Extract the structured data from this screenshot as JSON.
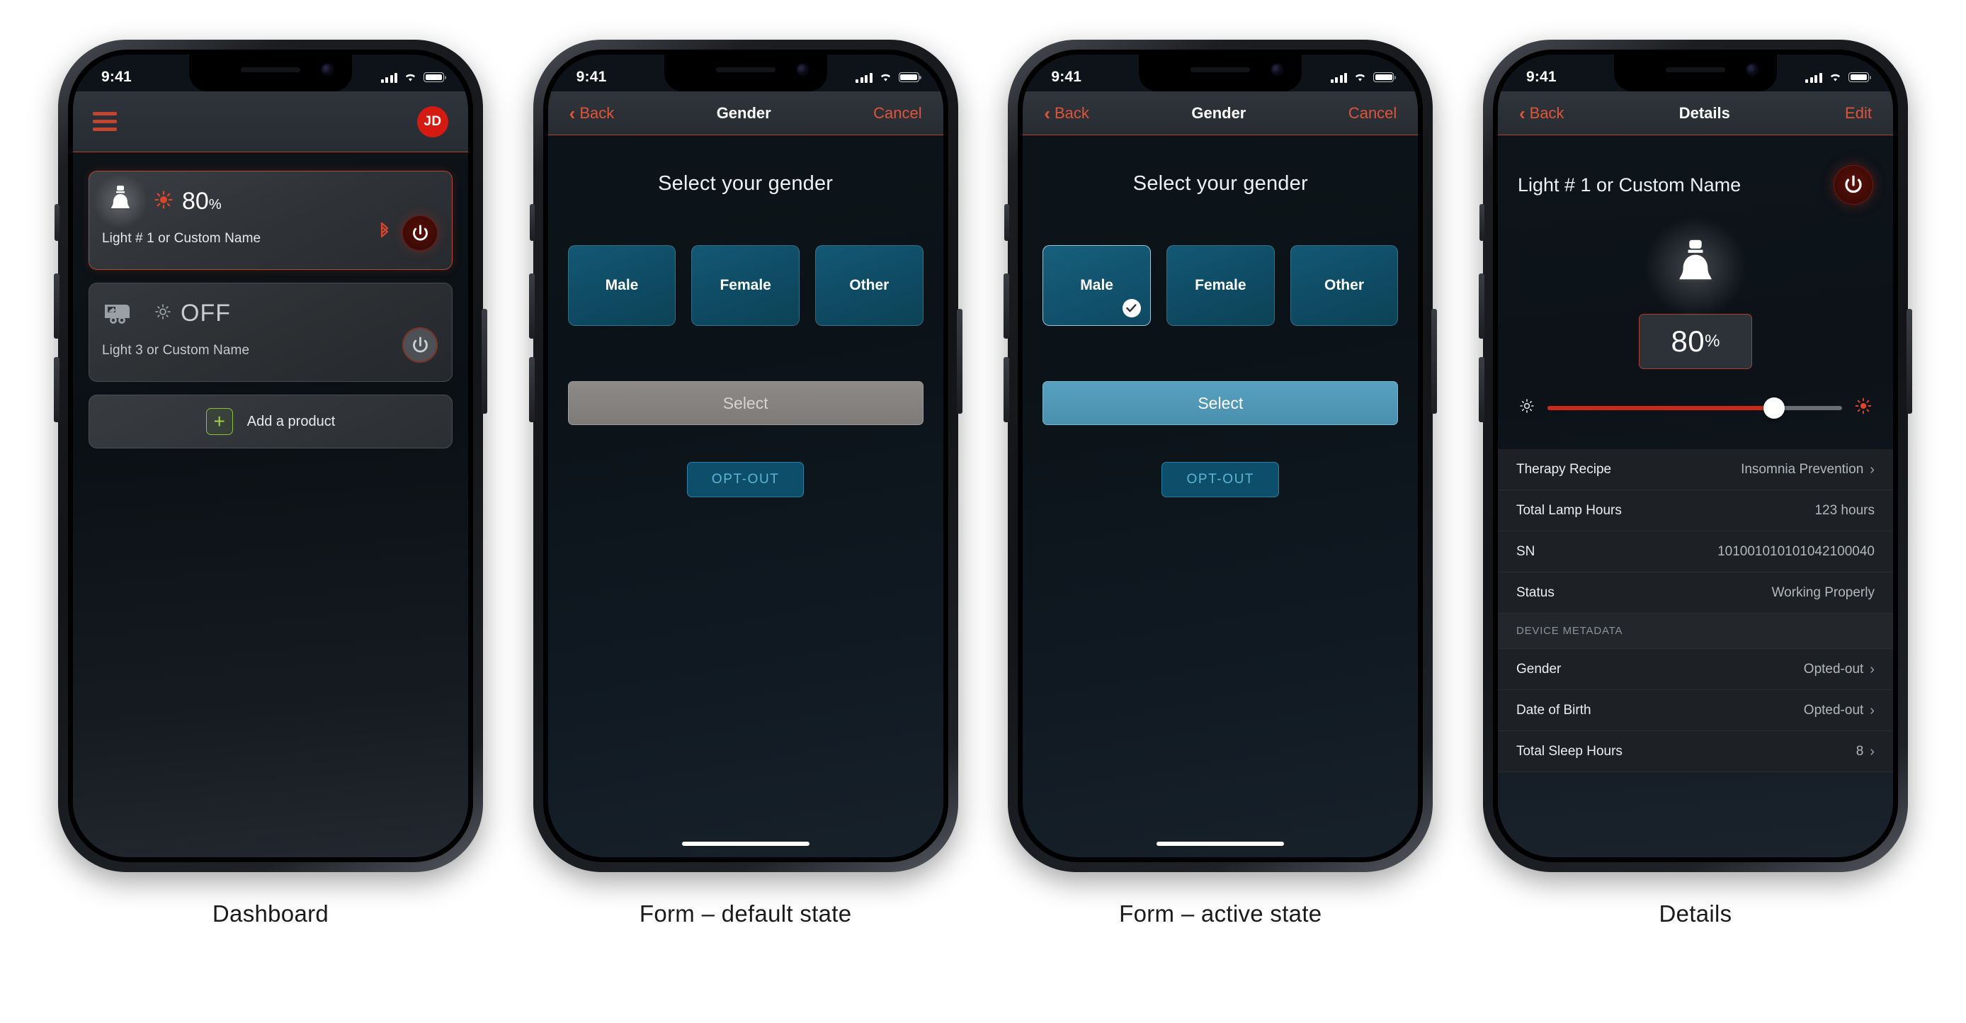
{
  "statusbar": {
    "time": "9:41"
  },
  "screens": [
    {
      "caption": "Dashboard",
      "header": {
        "menu_icon": "hamburger-menu-icon",
        "avatar_initials": "JD"
      },
      "devices": [
        {
          "icon": "light-bulb-icon",
          "brightness_icon": "sun-bright-icon",
          "value": "80",
          "unit": "%",
          "name": "Light # 1 or Custom Name",
          "bluetooth_icon": "bluetooth-icon",
          "power_icon": "power-icon",
          "state": "on"
        },
        {
          "icon": "trailer-icon",
          "brightness_icon": "sun-dim-icon",
          "value": "OFF",
          "unit": "",
          "name": "Light 3 or Custom Name",
          "bluetooth_icon": "",
          "power_icon": "power-icon",
          "state": "off"
        }
      ],
      "add_product": {
        "icon": "plus-icon",
        "label": "Add a product"
      }
    },
    {
      "caption": "Form – default state",
      "nav": {
        "back": "Back",
        "title": "Gender",
        "action": "Cancel"
      },
      "title": "Select your gender",
      "options": [
        {
          "label": "Male",
          "selected": false
        },
        {
          "label": "Female",
          "selected": false
        },
        {
          "label": "Other",
          "selected": false
        }
      ],
      "submit": {
        "label": "Select",
        "enabled": false
      },
      "optout": {
        "label": "OPT-OUT"
      }
    },
    {
      "caption": "Form – active state",
      "nav": {
        "back": "Back",
        "title": "Gender",
        "action": "Cancel"
      },
      "title": "Select your gender",
      "options": [
        {
          "label": "Male",
          "selected": true
        },
        {
          "label": "Female",
          "selected": false
        },
        {
          "label": "Other",
          "selected": false
        }
      ],
      "submit": {
        "label": "Select",
        "enabled": true
      },
      "optout": {
        "label": "OPT-OUT"
      }
    },
    {
      "caption": "Details",
      "nav": {
        "back": "Back",
        "title": "Details",
        "action": "Edit"
      },
      "device_name": "Light # 1 or Custom Name",
      "power_icon": "power-icon",
      "bulb_icon": "light-bulb-icon",
      "brightness": {
        "value": "80",
        "unit": "%",
        "percent": 77
      },
      "slider": {
        "low_icon": "sun-dim-icon",
        "high_icon": "sun-bright-icon"
      },
      "rows": [
        {
          "type": "row",
          "label": "Therapy Recipe",
          "value": "Insomnia Prevention",
          "chevron": true
        },
        {
          "type": "row",
          "label": "Total Lamp Hours",
          "value": "123 hours",
          "chevron": false
        },
        {
          "type": "row",
          "label": "SN",
          "value": "101001010101042100040",
          "chevron": false
        },
        {
          "type": "row",
          "label": "Status",
          "value": "Working Properly",
          "chevron": false
        },
        {
          "type": "section",
          "label": "DEVICE METADATA"
        },
        {
          "type": "row",
          "label": "Gender",
          "value": "Opted-out",
          "chevron": true
        },
        {
          "type": "row",
          "label": "Date of Birth",
          "value": "Opted-out",
          "chevron": true
        },
        {
          "type": "row",
          "label": "Total Sleep Hours",
          "value": "8",
          "chevron": true
        }
      ]
    }
  ],
  "colors": {
    "accent_red": "#c4452f",
    "accent_red_bright": "#e0543a",
    "avatar_red": "#d51a11",
    "tile_teal": "#0f4d66",
    "submit_blue": "#4a90ae",
    "green": "#8cbf3f",
    "slider_red": "#cb2a19"
  }
}
